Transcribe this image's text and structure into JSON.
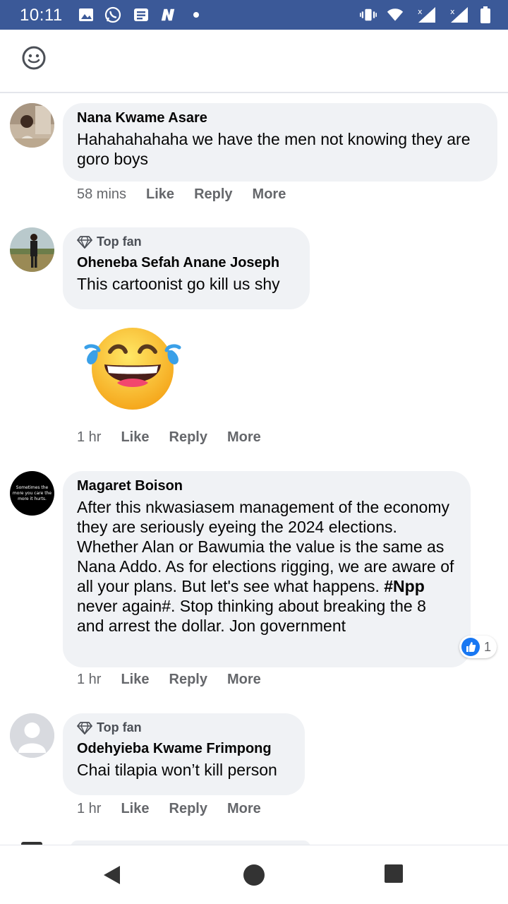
{
  "status_bar": {
    "time": "10:11",
    "icons": [
      "image-icon",
      "whatsapp-icon",
      "message-icon",
      "n-app-icon",
      "dot-icon",
      "vibrate-icon",
      "wifi-icon",
      "signal-icon",
      "signal-icon-2",
      "battery-icon"
    ]
  },
  "top_bar": {
    "emoji_icon": "emoji-icon"
  },
  "comments": [
    {
      "author": "Nana Kwame Asare",
      "text": "Hahahahahaha we have the men not knowing they are goro boys",
      "time": "58 mins",
      "like": "Like",
      "reply": "Reply",
      "more": "More"
    },
    {
      "badge": "Top fan",
      "author": "Oheneba Sefah Anane Joseph",
      "text": "This cartoonist go kill us shy",
      "sticker": "laughing-tears-emoji",
      "time": "1 hr",
      "like": "Like",
      "reply": "Reply",
      "more": "More"
    },
    {
      "author": "Magaret Boison",
      "avatar_text": "Sometimes the more you care the more it hurts.",
      "text_before": "After this nkwasiasem management of the economy they are seriously eyeing the 2024 elections. Whether Alan or Bawumia the value is the same as Nana Addo. As for elections rigging, we are aware of all your plans. But let's see what happens. ",
      "hashtag": "#Npp",
      "text_after": " never again#. Stop thinking about breaking the 8 and arrest the dollar. Jon government",
      "reaction_count": "1",
      "time": "1 hr",
      "like": "Like",
      "reply": "Reply",
      "more": "More"
    },
    {
      "badge": "Top fan",
      "author": "Odehyieba Kwame Frimpong",
      "text": "Chai tilapia won’t kill person",
      "time": "1 hr",
      "like": "Like",
      "reply": "Reply",
      "more": "More"
    }
  ],
  "nav_bar": {
    "buttons": [
      "back-icon",
      "home-icon",
      "recents-icon"
    ]
  },
  "colors": {
    "status_bar": "#3b5998",
    "bubble": "#f0f2f5",
    "meta_text": "#65676b",
    "like_blue": "#1877f2"
  }
}
